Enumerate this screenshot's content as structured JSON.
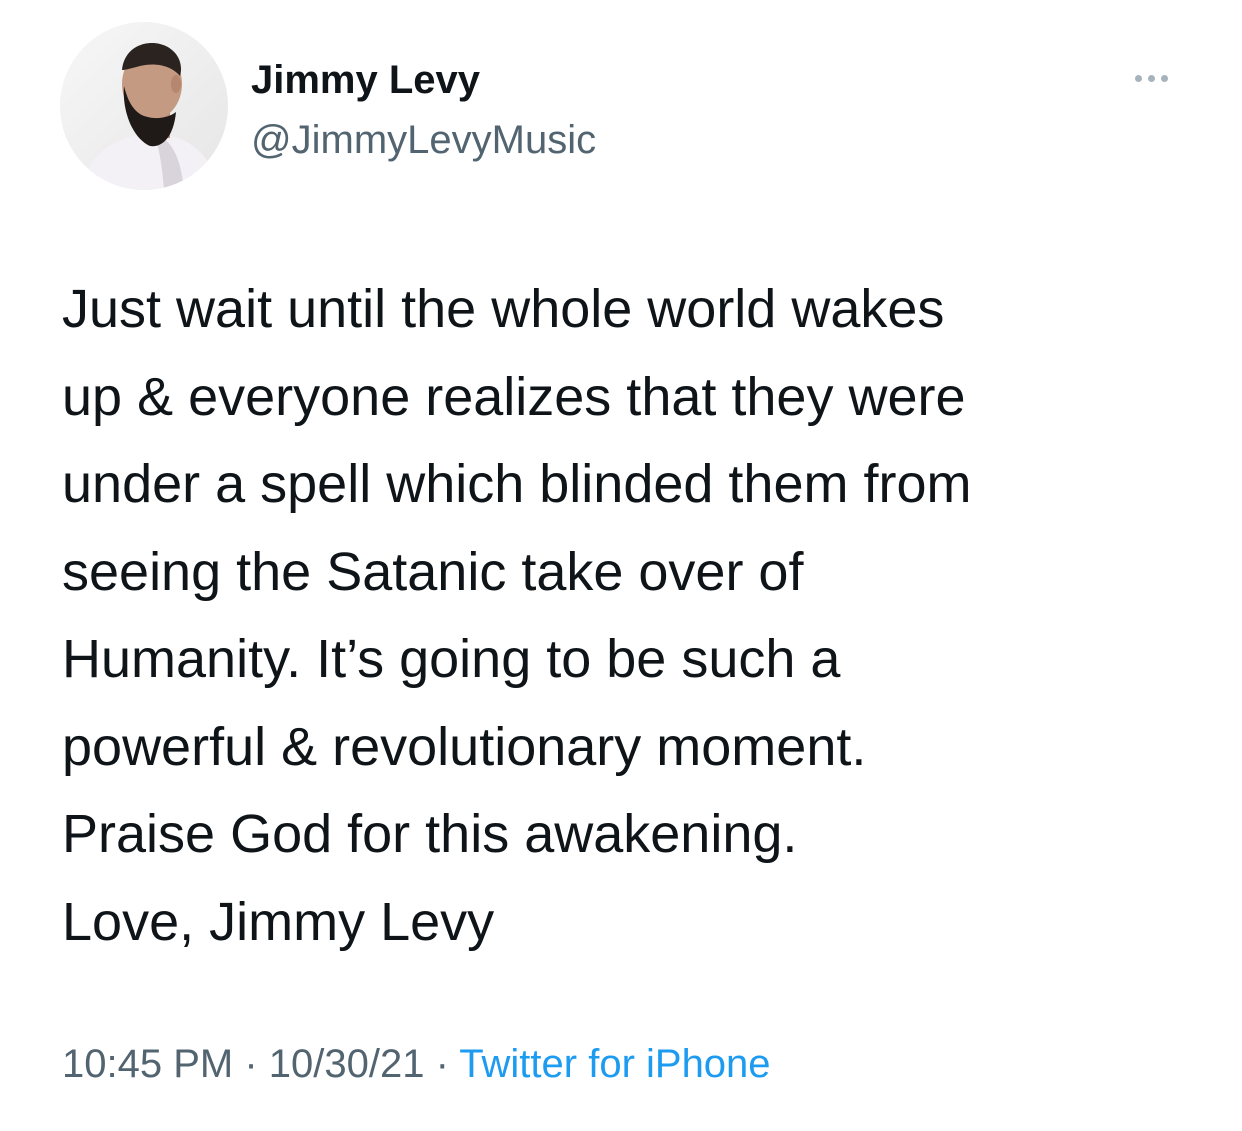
{
  "author": {
    "name": "Jimmy Levy",
    "handle": "@JimmyLevyMusic",
    "avatar_icon": "profile-photo"
  },
  "more_icon": "more-horizontal-icon",
  "tweet": {
    "lines": [
      "Just wait until the whole world wakes",
      "up & everyone realizes that they were",
      "under a spell which blinded them from",
      "seeing the Satanic take over of",
      "Humanity. It’s going to be such a",
      "powerful & revolutionary moment.",
      "Praise God for this awakening.",
      "Love, Jimmy Levy"
    ]
  },
  "meta": {
    "time": "10:45 PM",
    "separator": " · ",
    "date": "10/30/21",
    "source": "Twitter for iPhone"
  },
  "colors": {
    "text": "#0f1419",
    "secondary": "#536471",
    "link": "#1d9bf0"
  }
}
